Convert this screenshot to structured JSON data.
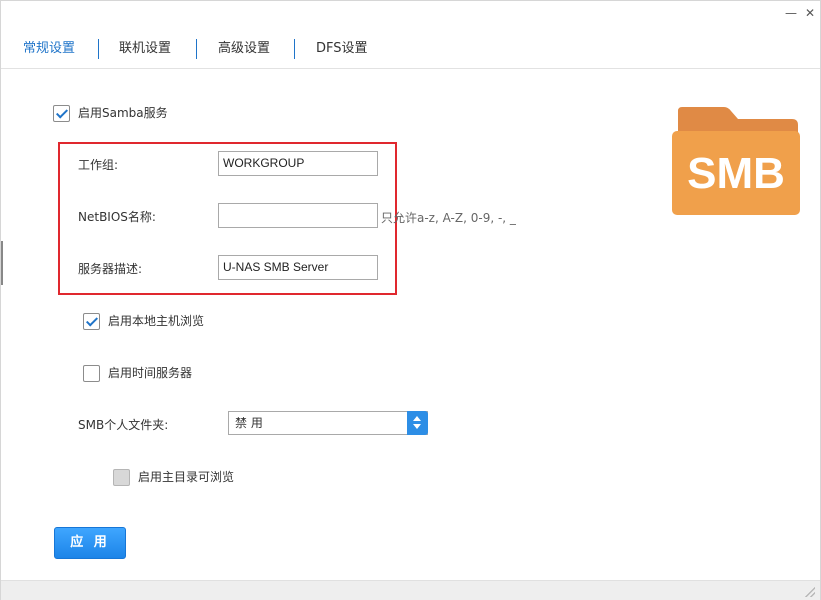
{
  "window": {
    "minimize_glyph": "—",
    "close_glyph": "✕"
  },
  "tabs": [
    {
      "label": "常规设置",
      "active": true
    },
    {
      "label": "联机设置",
      "active": false
    },
    {
      "label": "高级设置",
      "active": false
    },
    {
      "label": "DFS设置",
      "active": false
    }
  ],
  "samba": {
    "enable_label": "启用Samba服务",
    "enabled": true
  },
  "fields": {
    "workgroup_label": "工作组:",
    "workgroup_value": "WORKGROUP",
    "netbios_label": "NetBIOS名称:",
    "netbios_value": "",
    "netbios_hint": "只允许a-z, A-Z, 0-9, -, _",
    "server_desc_label": "服务器描述:",
    "server_desc_value": "U-NAS SMB Server"
  },
  "options": {
    "local_browse_label": "启用本地主机浏览",
    "local_browse_checked": true,
    "time_server_label": "启用时间服务器",
    "time_server_checked": false,
    "personal_folder_label": "SMB个人文件夹:",
    "personal_folder_value": "禁 用",
    "home_browse_label": "启用主目录可浏览",
    "home_browse_checked": false
  },
  "apply_label": "应 用",
  "logo": {
    "text": "SMB",
    "color": "#f0a04b",
    "tab_color": "#e08a45"
  },
  "colors": {
    "accent": "#1f74c9",
    "highlight_box": "#e0282e",
    "button": "#2d8ee6"
  }
}
